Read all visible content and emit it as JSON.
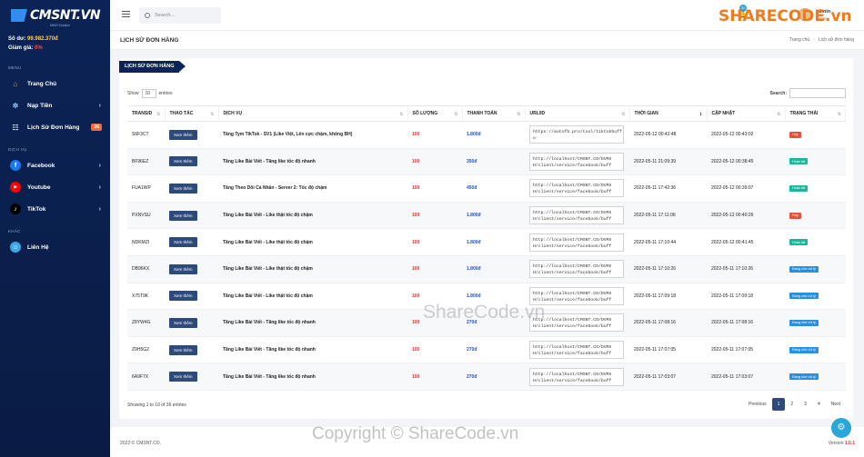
{
  "sidebar": {
    "logo": "CMSNT.VN",
    "logo_sub": "MMO Solution",
    "balance_label": "Số dư:",
    "balance_value": "99.982.370đ",
    "rate_label": "Giảm giá:",
    "rate_value": "0%",
    "sections": [
      "MENU",
      "DỊCH VỤ",
      "KHÁC"
    ],
    "menu": [
      {
        "label": "Trang Chủ"
      },
      {
        "label": "Nạp Tiền"
      },
      {
        "label": "Lịch Sử Đơn Hàng",
        "badge": "36"
      }
    ],
    "services": [
      {
        "label": "Facebook"
      },
      {
        "label": "Youtube"
      },
      {
        "label": "TikTok"
      }
    ],
    "other": [
      {
        "label": "Liên Hệ"
      }
    ]
  },
  "topbar": {
    "search_placeholder": "Search...",
    "notif_count": "31",
    "user_name": "admin",
    "user_role": "Admin"
  },
  "page": {
    "title": "LỊCH SỬ ĐƠN HÀNG",
    "breadcrumb_home": "Trang chủ",
    "breadcrumb_current": "Lịch sử đơn hàng"
  },
  "card": {
    "tag": "LỊCH SỬ ĐƠN HÀNG",
    "show_label": "Show",
    "show_value": "10",
    "entries_label": "entries",
    "search_label": "Search:",
    "columns": [
      "TRANSID",
      "THAO TÁC",
      "DỊCH VỤ",
      "SỐ LƯỢNG",
      "THANH TOÁN",
      "URL/ID",
      "THỜI GIAN",
      "CẬP NHẬT",
      "TRẠNG THÁI"
    ],
    "button_label": "Xem thêm",
    "rows": [
      {
        "id": "S6F3CT",
        "service": "Tăng Tym TikTok - SV1 (Like Việt, Lên cực chậm, không BH)",
        "qty": "100",
        "pay": "1.800đ",
        "url": "https://autofb.pro/tool/tiktokbuff",
        "url2": "o",
        "time": "2022-05-12 00:42:48",
        "updated": "2022-05-12 00:43:02",
        "status": "Huỷ",
        "status_color": "red"
      },
      {
        "id": "BF96EZ",
        "service": "Tăng Like Bài Viết - Tăng like tốc độ nhanh",
        "qty": "100",
        "pay": "350đ",
        "url": "http://localhost/CMSNT.CO/DVMX",
        "url2": "H/client/service/facebook/buff",
        "time": "2022-05-11 21:09:39",
        "updated": "2022-05-12 00:38:45",
        "status": "Hoàn tất",
        "status_color": "green"
      },
      {
        "id": "FUA1WP",
        "service": "Tăng Theo Dõi Cá Nhân - Server 2: Tốc độ chậm",
        "qty": "100",
        "pay": "450đ",
        "url": "http://localhost/CMSNT.CO/DVMX",
        "url2": "H/client/service/facebook/buff",
        "time": "2022-05-11 17:42:36",
        "updated": "2022-05-12 00:39:07",
        "status": "Hoàn tất",
        "status_color": "green"
      },
      {
        "id": "PXNVSU",
        "service": "Tăng Like Bài Viết - Like thật tốc độ chậm",
        "qty": "100",
        "pay": "1.800đ",
        "url": "http://localhost/CMSNT.CO/DVMX",
        "url2": "H/client/service/facebook/buff",
        "time": "2022-05-11 17:11:06",
        "updated": "2022-05-12 00:40:26",
        "status": "Huỷ",
        "status_color": "red"
      },
      {
        "id": "NDKMZI",
        "service": "Tăng Like Bài Viết - Like thật tốc độ chậm",
        "qty": "100",
        "pay": "1.800đ",
        "url": "http://localhost/CMSNT.CO/DVMX",
        "url2": "H/client/service/facebook/buff",
        "time": "2022-05-11 17:10:44",
        "updated": "2022-05-12 00:41:45",
        "status": "Hoàn tất",
        "status_color": "green"
      },
      {
        "id": "DB96KX",
        "service": "Tăng Like Bài Viết - Like thật tốc độ chậm",
        "qty": "100",
        "pay": "1.800đ",
        "url": "http://localhost/CMSNT.CO/DVMX",
        "url2": "H/client/service/facebook/buff",
        "time": "2022-05-11 17:10:26",
        "updated": "2022-05-11 17:10:26",
        "status": "Đang chờ xử lý",
        "status_color": "blue"
      },
      {
        "id": "X75T9K",
        "service": "Tăng Like Bài Viết - Like thật tốc độ chậm",
        "qty": "100",
        "pay": "1.800đ",
        "url": "http://localhost/CMSNT.CO/DVMX",
        "url2": "H/client/service/facebook/buff",
        "time": "2022-05-11 17:09:18",
        "updated": "2022-05-11 17:09:18",
        "status": "Đang chờ xử lý",
        "status_color": "blue"
      },
      {
        "id": "Z8YW4G",
        "service": "Tăng Like Bài Viết - Tăng like tốc độ nhanh",
        "qty": "100",
        "pay": "270đ",
        "url": "http://localhost/CMSNT.CO/DVMX",
        "url2": "H/client/service/facebook/buff",
        "time": "2022-05-11 17:08:16",
        "updated": "2022-05-11 17:08:16",
        "status": "Đang chờ xử lý",
        "status_color": "blue"
      },
      {
        "id": "Z9H5G2",
        "service": "Tăng Like Bài Viết - Tăng like tốc độ nhanh",
        "qty": "100",
        "pay": "270đ",
        "url": "http://localhost/CMSNT.CO/DVMX",
        "url2": "H/client/service/facebook/buff",
        "time": "2022-05-11 17:07:05",
        "updated": "2022-05-11 17:07:05",
        "status": "Đang chờ xử lý",
        "status_color": "blue"
      },
      {
        "id": "6A9F7X",
        "service": "Tăng Like Bài Viết - Tăng like tốc độ nhanh",
        "qty": "100",
        "pay": "270đ",
        "url": "http://localhost/CMSNT.CO/DVMX",
        "url2": "H/client/service/facebook/buff",
        "time": "2022-05-11 17:03:07",
        "updated": "2022-05-11 17:03:07",
        "status": "Đang chờ xử lý",
        "status_color": "blue"
      }
    ],
    "info": "Showing 1 to 10 of 36 entries",
    "pager": {
      "prev": "Previous",
      "pages": [
        "1",
        "2",
        "3",
        "4"
      ],
      "next": "Next",
      "active": "1"
    }
  },
  "footer": {
    "left": "2022 © CMSNT.CO.",
    "version_label": "Version",
    "version_value": "1.0.1"
  },
  "watermarks": {
    "top": "SHARECODE.vn",
    "mid": "ShareCode.vn",
    "bottom": "Copyright © ShareCode.vn"
  },
  "colors": {
    "sidebar": "#0b2356",
    "primary_button": "#2d4a7a",
    "status_red": "#e5533d",
    "status_green": "#1fb59a",
    "status_blue": "#2b8fe0"
  }
}
